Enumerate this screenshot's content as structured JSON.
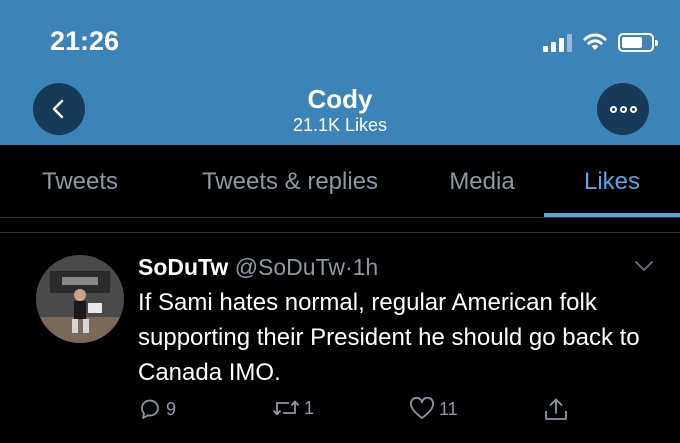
{
  "status_bar": {
    "time": "21:26",
    "icons": [
      "signal-icon",
      "wifi-icon",
      "battery-icon"
    ]
  },
  "header": {
    "title": "Cody",
    "subtitle": "21.1K Likes",
    "back_icon": "chevron-left-icon",
    "more_icon": "more-icon",
    "background": "#3c84b7"
  },
  "tabs": [
    {
      "label": "Tweets",
      "active": false
    },
    {
      "label": "Tweets & replies",
      "active": false
    },
    {
      "label": "Media",
      "active": false
    },
    {
      "label": "Likes",
      "active": true
    }
  ],
  "tweet": {
    "display_name": "SoDuTw",
    "handle": "@SoDuTw",
    "separator": "·",
    "time": "1h",
    "text": "If Sami hates normal, regular American folk supporting their President he should go back to Canada IMO.",
    "actions": {
      "reply_count": "9",
      "retweet_count": "1",
      "like_count": "11"
    }
  },
  "colors": {
    "accent": "#57a6e8",
    "muted": "#8b98a5",
    "background": "#000000"
  }
}
